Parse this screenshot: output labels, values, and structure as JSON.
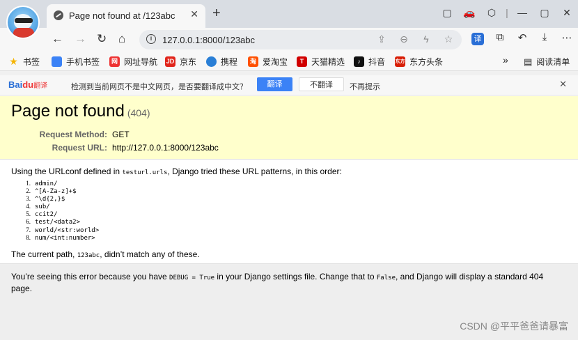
{
  "browser": {
    "tab": {
      "title": "Page not found at /123abc",
      "close": "✕"
    },
    "new_tab": "+",
    "window_icons": [
      "▢",
      "🚗",
      "⬡",
      "|",
      "—",
      "▢",
      "✕"
    ],
    "address": {
      "url": "127.0.0.1:8000/123abc"
    },
    "bookmarks": [
      {
        "label": "书签",
        "icon": "star-icon",
        "color": "#f5b400"
      },
      {
        "label": "手机书签",
        "icon": "phone-icon",
        "color": "#3b82f6"
      },
      {
        "label": "网址导航",
        "icon": "nav-icon",
        "color": "#e33"
      },
      {
        "label": "京东",
        "icon": "jd-icon",
        "color": "#e1251b"
      },
      {
        "label": "携程",
        "icon": "ctrip-icon",
        "color": "#2a7fd6"
      },
      {
        "label": "爱淘宝",
        "icon": "taobao-icon",
        "color": "#ff5000"
      },
      {
        "label": "天猫精选",
        "icon": "tmall-icon",
        "color": "#d10000"
      },
      {
        "label": "抖音",
        "icon": "douyin-icon",
        "color": "#111"
      },
      {
        "label": "东方头条",
        "icon": "dftt-icon",
        "color": "#d81e06"
      }
    ],
    "more": "»",
    "reading_list": "阅读清单"
  },
  "translate_bar": {
    "logo_text": "Bai",
    "logo_red": "du",
    "logo_suffix": "翻译",
    "message": "检测到当前网页不是中文网页，是否要翻译成中文？",
    "translate_button": "翻译",
    "no_translate_button": "不翻译",
    "never_translate": "不再提示",
    "close": "✕"
  },
  "page": {
    "title": "Page not found",
    "status_code": "(404)",
    "request_method_label": "Request Method:",
    "request_method": "GET",
    "request_url_label": "Request URL:",
    "request_url": "http://127.0.0.1:8000/123abc",
    "urlconf_prefix": "Using the URLconf defined in ",
    "urlconf_module": "testurl.urls",
    "urlconf_suffix": ", Django tried these URL patterns, in this order:",
    "patterns": [
      {
        "num": "1.",
        "pattern": "admin/"
      },
      {
        "num": "2.",
        "pattern": "^[A-Za-z]+$"
      },
      {
        "num": "3.",
        "pattern": "^\\d{2,}$"
      },
      {
        "num": "4.",
        "pattern": "sub/"
      },
      {
        "num": "5.",
        "pattern": "ccit2/"
      },
      {
        "num": "6.",
        "pattern": "test/<data2>"
      },
      {
        "num": "7.",
        "pattern": "world/<str:world>"
      },
      {
        "num": "8.",
        "pattern": "num/<int:number>"
      }
    ],
    "current_path_prefix": "The current path, ",
    "current_path": "123abc",
    "current_path_suffix": ", didn’t match any of these.",
    "explanation_part1": "You’re seeing this error because you have ",
    "debug_code": "DEBUG = True",
    "explanation_part2": " in your Django settings file. Change that to ",
    "false_code": "False",
    "explanation_part3": ", and Django will display a standard 404 page."
  },
  "watermark": "CSDN @平平爸爸请暴富"
}
